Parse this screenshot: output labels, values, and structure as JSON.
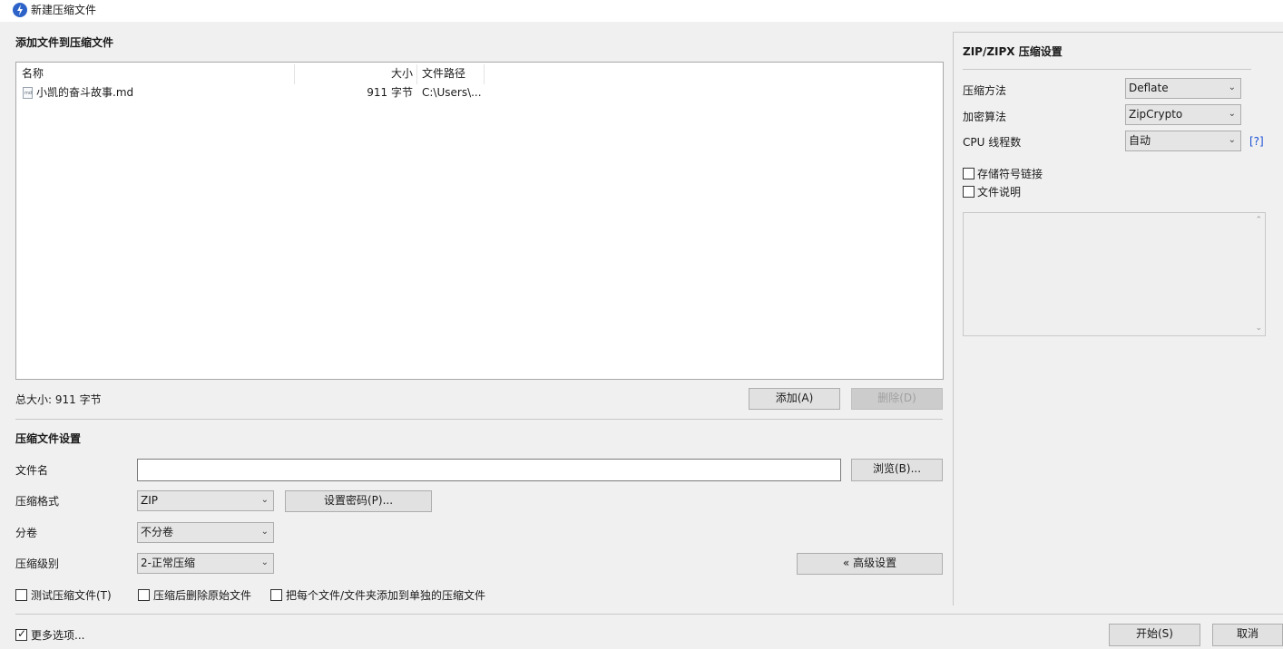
{
  "window": {
    "title": "新建压缩文件"
  },
  "files_section": {
    "heading": "添加文件到压缩文件",
    "columns": [
      "名称",
      "大小",
      "文件路径"
    ],
    "rows": [
      {
        "name": "小凯的奋斗故事.md",
        "size": "911 字节",
        "path": "C:\\Users\\...",
        "icon": "markdown-file-icon"
      }
    ],
    "total_size": "总大小: 911 字节",
    "add_label": "添加(A)",
    "delete_label": "删除(D)"
  },
  "archive_settings": {
    "heading": "压缩文件设置",
    "filename_label": "文件名",
    "filename_value": "",
    "browse_label": "浏览(B)...",
    "format_label": "压缩格式",
    "format_value": "ZIP",
    "set_password_label": "设置密码(P)...",
    "split_label": "分卷",
    "split_value": "不分卷",
    "level_label": "压缩级别",
    "level_value": "2-正常压缩",
    "advanced_label": "« 高级设置",
    "check_test": "测试压缩文件(T)",
    "check_delete_original": "压缩后删除原始文件",
    "check_separate": "把每个文件/文件夹添加到单独的压缩文件"
  },
  "zip_settings": {
    "heading": "ZIP/ZIPX 压缩设置",
    "method_label": "压缩方法",
    "method_value": "Deflate",
    "encryption_label": "加密算法",
    "encryption_value": "ZipCrypto",
    "threads_label": "CPU 线程数",
    "threads_value": "自动",
    "help_label": "[?]",
    "store_symlinks_label": "存储符号链接",
    "file_comment_label": "文件说明",
    "comment_value": ""
  },
  "footer": {
    "more_options_label": "更多选项...",
    "more_options_checked": true,
    "start_label": "开始(S)",
    "cancel_label": "取消"
  },
  "colors": {
    "accent": "#2d63c8",
    "link": "#1a4fd6"
  }
}
